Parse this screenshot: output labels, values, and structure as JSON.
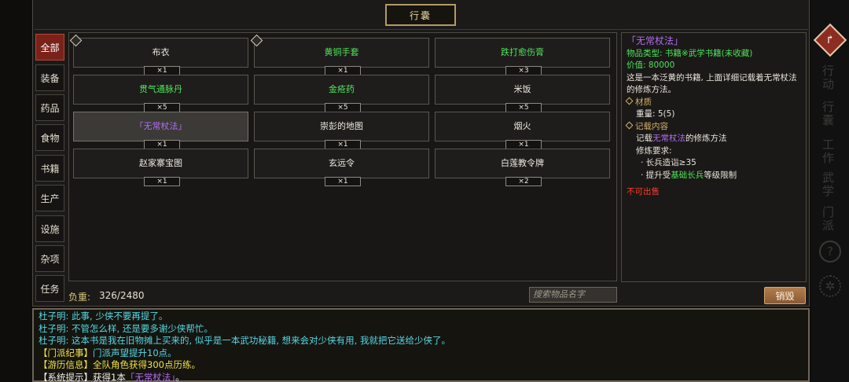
{
  "title": "行囊",
  "tabs": [
    "全部",
    "装备",
    "药品",
    "食物",
    "书籍",
    "生产",
    "设施",
    "杂项",
    "任务"
  ],
  "active_tab": "全部",
  "items": [
    {
      "name": "布衣",
      "qty": "×1",
      "color": "white",
      "tagged": true
    },
    {
      "name": "黄铜手套",
      "qty": "×1",
      "color": "green",
      "tagged": true
    },
    {
      "name": "跌打愈伤膏",
      "qty": "×3",
      "color": "green",
      "tagged": false
    },
    {
      "name": "贯气通脉丹",
      "qty": "×5",
      "color": "green",
      "tagged": false
    },
    {
      "name": "金疮药",
      "qty": "×5",
      "color": "green",
      "tagged": false
    },
    {
      "name": "米饭",
      "qty": "×5",
      "color": "white",
      "tagged": false
    },
    {
      "name": "「无常杖法」",
      "qty": "×1",
      "color": "purple",
      "tagged": false,
      "selected": true
    },
    {
      "name": "崇彭的地图",
      "qty": "×1",
      "color": "white",
      "tagged": false
    },
    {
      "name": "烟火",
      "qty": "×1",
      "color": "white",
      "tagged": false
    },
    {
      "name": "赵家寨宝图",
      "qty": "×1",
      "color": "white",
      "tagged": false
    },
    {
      "name": "玄远令",
      "qty": "×1",
      "color": "white",
      "tagged": false
    },
    {
      "name": "白莲教令牌",
      "qty": "×2",
      "color": "white",
      "tagged": false
    }
  ],
  "weight": {
    "label": "负重:",
    "value": "326/2480"
  },
  "search": {
    "placeholder": "搜索物品名字"
  },
  "destroy_label": "销毁",
  "detail": {
    "name": "「无常杖法」",
    "type": "物品类型: 书籍※武学书籍(未收藏)",
    "price": "价值: 80000",
    "desc": "这是一本泛黄的书籍, 上面详细记载着无常杖法的修炼方法。",
    "material_header": "材质",
    "weight_line": "重量: 5(5)",
    "record_header": "记载内容",
    "record_prefix": "记载",
    "record_skill": "无常杖法",
    "record_suffix": "的修炼方法",
    "req_header": "修炼要求:",
    "req1": "· 长兵造诣≥35",
    "req2_prefix": "· 提升受",
    "req2_skill": "基础长兵",
    "req2_suffix": "等级限制",
    "unsellable": "不可出售"
  },
  "log": {
    "l1": "杜子明: 此事, 少侠不要再提了。",
    "l2": "杜子明: 不管怎么样, 还是要多谢少侠帮忙。",
    "l3": "杜子明: 这本书是我在旧物摊上买来的, 似乎是一本武功秘籍, 想来会对少侠有用, 我就把它送给少侠了。",
    "l4_tag": "【门派纪事】",
    "l4_text": "门派声望提升10点。",
    "l5_tag": "【游历信息】",
    "l5_text": "全队角色获得300点历练。",
    "l6_tag": "【系统提示】",
    "l6_text": "获得1本",
    "l6_item": "「无常杖法」",
    "l6_end": "。"
  },
  "sidebar": {
    "side1": "行动",
    "side2": "行囊",
    "side3": "工作",
    "side4": "武学",
    "side5": "门派",
    "side6": "?"
  },
  "colors": {
    "green": "#4fe25c",
    "purple": "#b26cf0",
    "cyan": "#56d7e3",
    "yellow": "#f0e24a",
    "accent_red": "#7a2219"
  }
}
